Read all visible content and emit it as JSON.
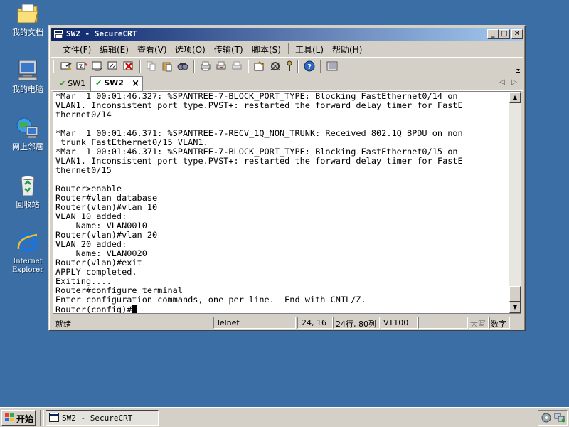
{
  "desktop": {
    "icons": [
      {
        "label": "我的文档",
        "icon": "my-documents-icon"
      },
      {
        "label": "我的电脑",
        "icon": "my-computer-icon"
      },
      {
        "label": "网上邻居",
        "icon": "network-places-icon"
      },
      {
        "label": "回收站",
        "icon": "recycle-bin-icon"
      },
      {
        "label": "Internet\nExplorer",
        "icon": "internet-explorer-icon"
      }
    ]
  },
  "window": {
    "title": "SW2 - SecureCRT",
    "minimize": "_",
    "maximize": "□",
    "close": "✕"
  },
  "menu": {
    "items": [
      "文件(F)",
      "编辑(E)",
      "查看(V)",
      "选项(O)",
      "传输(T)",
      "脚本(S)",
      "工具(L)",
      "帮助(H)"
    ]
  },
  "tabs": {
    "items": [
      {
        "label": "SW1",
        "active": false
      },
      {
        "label": "SW2",
        "active": true
      }
    ],
    "close": "×",
    "prev": "◁",
    "next": "▷"
  },
  "terminal": {
    "lines": [
      "*Mar  1 00:01:46.327: %SPANTREE-7-BLOCK_PORT_TYPE: Blocking FastEthernet0/14 on",
      "VLAN1. Inconsistent port type.PVST+: restarted the forward delay timer for FastE",
      "thernet0/14",
      "",
      "*Mar  1 00:01:46.371: %SPANTREE-7-RECV_1Q_NON_TRUNK: Received 802.1Q BPDU on non",
      " trunk FastEthernet0/15 VLAN1.",
      "*Mar  1 00:01:46.371: %SPANTREE-7-BLOCK_PORT_TYPE: Blocking FastEthernet0/15 on",
      "VLAN1. Inconsistent port type.PVST+: restarted the forward delay timer for FastE",
      "thernet0/15",
      "",
      "Router>enable",
      "Router#vlan database",
      "Router(vlan)#vlan 10",
      "VLAN 10 added:",
      "    Name: VLAN0010",
      "Router(vlan)#vlan 20",
      "VLAN 20 added:",
      "    Name: VLAN0020",
      "Router(vlan)#exit",
      "APPLY completed.",
      "Exiting....",
      "Router#configure terminal",
      "Enter configuration commands, one per line.  End with CNTL/Z.",
      "Router(config)#"
    ]
  },
  "status": {
    "ready": "就绪",
    "protocol": "Telnet",
    "position": "24, 16",
    "size": "24行, 80列",
    "emulation": "VT100",
    "caps": "大写",
    "num": "数字"
  },
  "taskbar": {
    "start": "开始",
    "task": "SW2 - SecureCRT"
  },
  "colors": {
    "desktop": "#3a6ea5",
    "title_start": "#0a246a",
    "title_end": "#a6caf0",
    "chrome": "#d4d0c8"
  }
}
